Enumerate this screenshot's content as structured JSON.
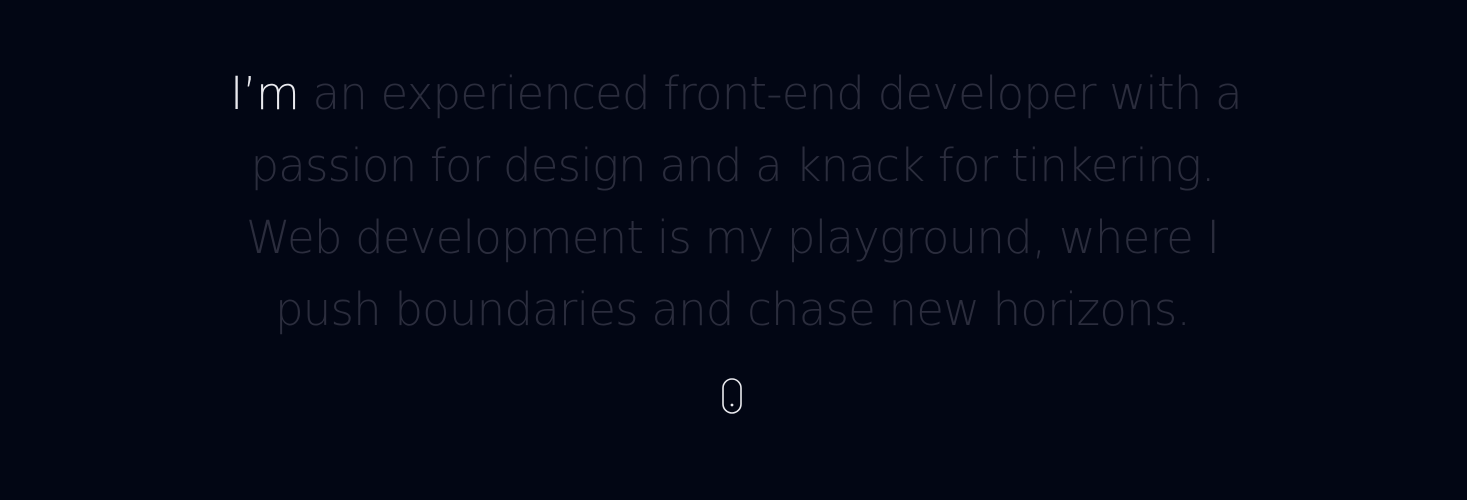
{
  "intro": {
    "lead": "I’m",
    "line1_rest": "an experienced front-end developer with a",
    "line2": "passion for design and a knack for tinkering.",
    "line3": "Web development is my playground, where I",
    "line4": "push boundaries and chase new horizons."
  },
  "scroll_indicator": {
    "icon": "mouse-scroll-icon"
  },
  "colors": {
    "background": "#020614",
    "highlight_text": "#e9e9ee",
    "dim_text": "#2b2d3d"
  }
}
